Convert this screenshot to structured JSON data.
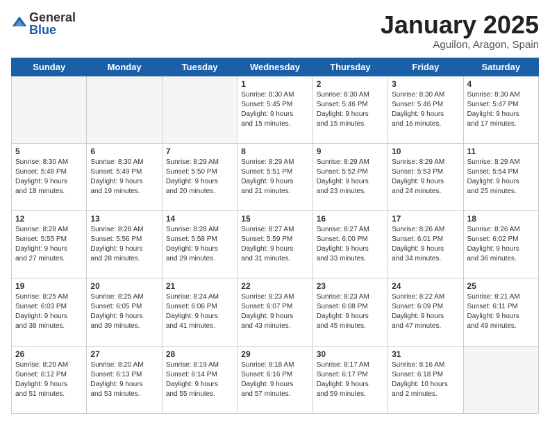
{
  "logo": {
    "general": "General",
    "blue": "Blue"
  },
  "title": "January 2025",
  "location": "Aguilon, Aragon, Spain",
  "days_of_week": [
    "Sunday",
    "Monday",
    "Tuesday",
    "Wednesday",
    "Thursday",
    "Friday",
    "Saturday"
  ],
  "weeks": [
    [
      {
        "day": "",
        "info": ""
      },
      {
        "day": "",
        "info": ""
      },
      {
        "day": "",
        "info": ""
      },
      {
        "day": "1",
        "info": "Sunrise: 8:30 AM\nSunset: 5:45 PM\nDaylight: 9 hours\nand 15 minutes."
      },
      {
        "day": "2",
        "info": "Sunrise: 8:30 AM\nSunset: 5:46 PM\nDaylight: 9 hours\nand 15 minutes."
      },
      {
        "day": "3",
        "info": "Sunrise: 8:30 AM\nSunset: 5:46 PM\nDaylight: 9 hours\nand 16 minutes."
      },
      {
        "day": "4",
        "info": "Sunrise: 8:30 AM\nSunset: 5:47 PM\nDaylight: 9 hours\nand 17 minutes."
      }
    ],
    [
      {
        "day": "5",
        "info": "Sunrise: 8:30 AM\nSunset: 5:48 PM\nDaylight: 9 hours\nand 18 minutes."
      },
      {
        "day": "6",
        "info": "Sunrise: 8:30 AM\nSunset: 5:49 PM\nDaylight: 9 hours\nand 19 minutes."
      },
      {
        "day": "7",
        "info": "Sunrise: 8:29 AM\nSunset: 5:50 PM\nDaylight: 9 hours\nand 20 minutes."
      },
      {
        "day": "8",
        "info": "Sunrise: 8:29 AM\nSunset: 5:51 PM\nDaylight: 9 hours\nand 21 minutes."
      },
      {
        "day": "9",
        "info": "Sunrise: 8:29 AM\nSunset: 5:52 PM\nDaylight: 9 hours\nand 23 minutes."
      },
      {
        "day": "10",
        "info": "Sunrise: 8:29 AM\nSunset: 5:53 PM\nDaylight: 9 hours\nand 24 minutes."
      },
      {
        "day": "11",
        "info": "Sunrise: 8:29 AM\nSunset: 5:54 PM\nDaylight: 9 hours\nand 25 minutes."
      }
    ],
    [
      {
        "day": "12",
        "info": "Sunrise: 8:28 AM\nSunset: 5:55 PM\nDaylight: 9 hours\nand 27 minutes."
      },
      {
        "day": "13",
        "info": "Sunrise: 8:28 AM\nSunset: 5:56 PM\nDaylight: 9 hours\nand 28 minutes."
      },
      {
        "day": "14",
        "info": "Sunrise: 8:28 AM\nSunset: 5:58 PM\nDaylight: 9 hours\nand 29 minutes."
      },
      {
        "day": "15",
        "info": "Sunrise: 8:27 AM\nSunset: 5:59 PM\nDaylight: 9 hours\nand 31 minutes."
      },
      {
        "day": "16",
        "info": "Sunrise: 8:27 AM\nSunset: 6:00 PM\nDaylight: 9 hours\nand 33 minutes."
      },
      {
        "day": "17",
        "info": "Sunrise: 8:26 AM\nSunset: 6:01 PM\nDaylight: 9 hours\nand 34 minutes."
      },
      {
        "day": "18",
        "info": "Sunrise: 8:26 AM\nSunset: 6:02 PM\nDaylight: 9 hours\nand 36 minutes."
      }
    ],
    [
      {
        "day": "19",
        "info": "Sunrise: 8:25 AM\nSunset: 6:03 PM\nDaylight: 9 hours\nand 38 minutes."
      },
      {
        "day": "20",
        "info": "Sunrise: 8:25 AM\nSunset: 6:05 PM\nDaylight: 9 hours\nand 39 minutes."
      },
      {
        "day": "21",
        "info": "Sunrise: 8:24 AM\nSunset: 6:06 PM\nDaylight: 9 hours\nand 41 minutes."
      },
      {
        "day": "22",
        "info": "Sunrise: 8:23 AM\nSunset: 6:07 PM\nDaylight: 9 hours\nand 43 minutes."
      },
      {
        "day": "23",
        "info": "Sunrise: 8:23 AM\nSunset: 6:08 PM\nDaylight: 9 hours\nand 45 minutes."
      },
      {
        "day": "24",
        "info": "Sunrise: 8:22 AM\nSunset: 6:09 PM\nDaylight: 9 hours\nand 47 minutes."
      },
      {
        "day": "25",
        "info": "Sunrise: 8:21 AM\nSunset: 6:11 PM\nDaylight: 9 hours\nand 49 minutes."
      }
    ],
    [
      {
        "day": "26",
        "info": "Sunrise: 8:20 AM\nSunset: 6:12 PM\nDaylight: 9 hours\nand 51 minutes."
      },
      {
        "day": "27",
        "info": "Sunrise: 8:20 AM\nSunset: 6:13 PM\nDaylight: 9 hours\nand 53 minutes."
      },
      {
        "day": "28",
        "info": "Sunrise: 8:19 AM\nSunset: 6:14 PM\nDaylight: 9 hours\nand 55 minutes."
      },
      {
        "day": "29",
        "info": "Sunrise: 8:18 AM\nSunset: 6:16 PM\nDaylight: 9 hours\nand 57 minutes."
      },
      {
        "day": "30",
        "info": "Sunrise: 8:17 AM\nSunset: 6:17 PM\nDaylight: 9 hours\nand 59 minutes."
      },
      {
        "day": "31",
        "info": "Sunrise: 8:16 AM\nSunset: 6:18 PM\nDaylight: 10 hours\nand 2 minutes."
      },
      {
        "day": "",
        "info": ""
      }
    ]
  ]
}
